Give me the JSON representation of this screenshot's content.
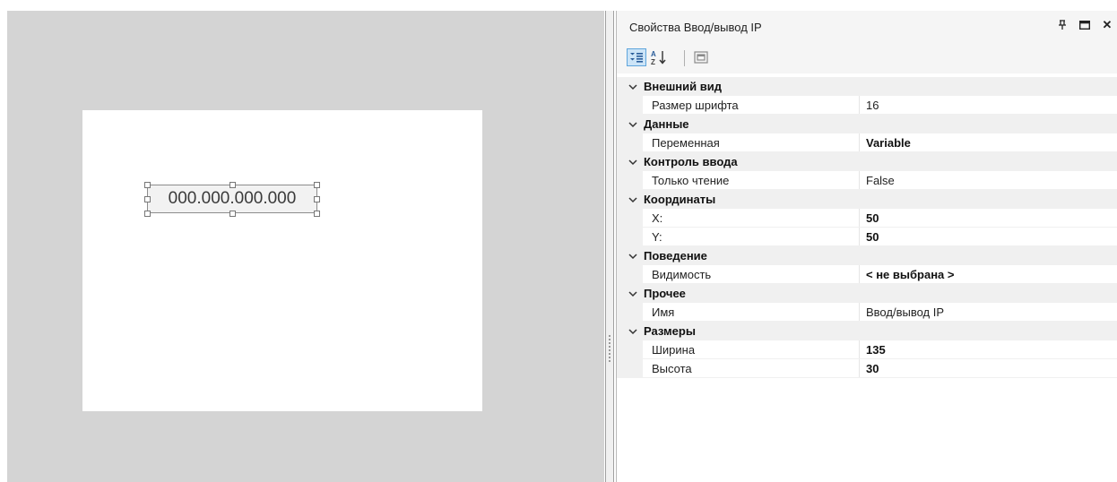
{
  "designer": {
    "ip_field_text": "000.000.000.000"
  },
  "panel": {
    "title": "Свойства Ввод/вывод IP",
    "pin_glyph": "Ру",
    "pin_icon": "pin-icon",
    "maximize_icon": "maximize-icon",
    "close_glyph": "✕",
    "toolbar": {
      "categorized_icon": "categorized-view-icon",
      "alphabetical_icon": "sort-alphabetical-icon",
      "property_pages_icon": "property-pages-icon"
    }
  },
  "properties": {
    "categories": [
      {
        "label": "Внешний вид",
        "expanded": true,
        "items": [
          {
            "name": "Размер шрифта",
            "value": "16",
            "bold": false
          }
        ]
      },
      {
        "label": "Данные",
        "expanded": true,
        "items": [
          {
            "name": "Переменная",
            "value": "Variable",
            "bold": true
          }
        ]
      },
      {
        "label": "Контроль ввода",
        "expanded": true,
        "items": [
          {
            "name": "Только чтение",
            "value": "False",
            "bold": false
          }
        ]
      },
      {
        "label": "Координаты",
        "expanded": true,
        "items": [
          {
            "name": "X:",
            "value": "50",
            "bold": true
          },
          {
            "name": "Y:",
            "value": "50",
            "bold": true
          }
        ]
      },
      {
        "label": "Поведение",
        "expanded": true,
        "items": [
          {
            "name": "Видимость",
            "value": "< не выбрана >",
            "bold": true
          }
        ]
      },
      {
        "label": "Прочее",
        "expanded": true,
        "items": [
          {
            "name": "Имя",
            "value": "Ввод/вывод IP",
            "bold": false
          }
        ]
      },
      {
        "label": "Размеры",
        "expanded": true,
        "items": [
          {
            "name": "Ширина",
            "value": "135",
            "bold": true
          },
          {
            "name": "Высота",
            "value": "30",
            "bold": true
          }
        ]
      }
    ]
  },
  "colors": {
    "designer_bg": "#d4d4d4",
    "category_bg": "#f0f0f0",
    "toolbar_active": "#cce4f7"
  }
}
